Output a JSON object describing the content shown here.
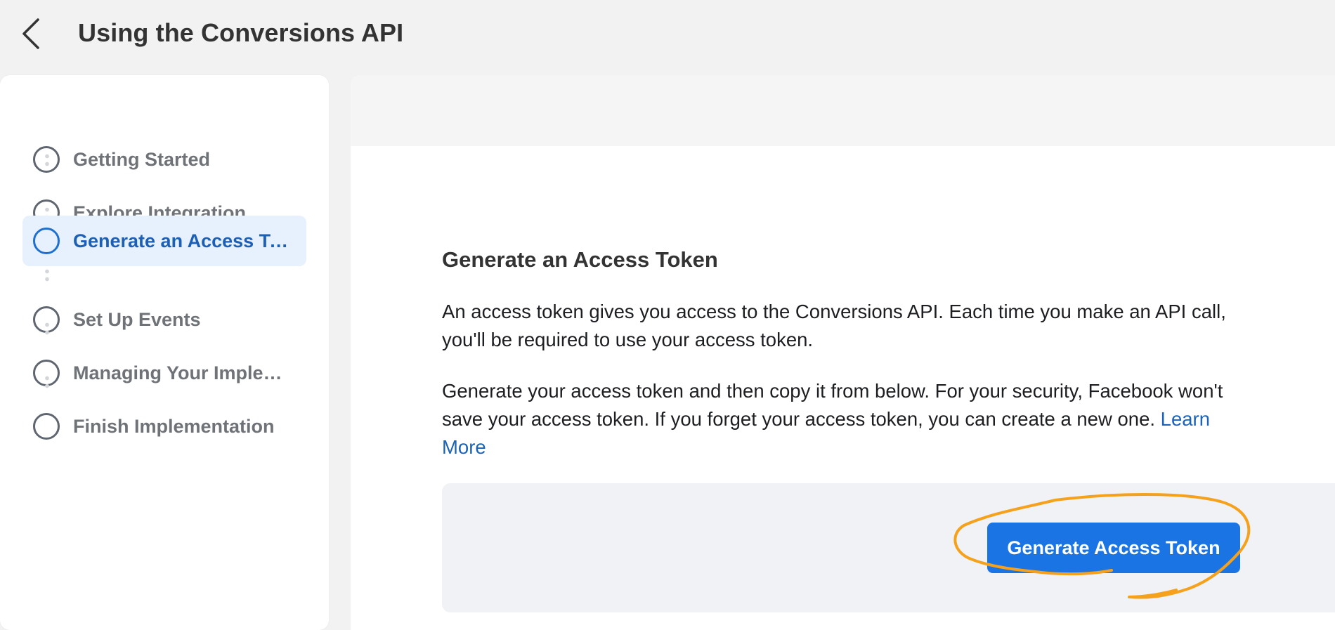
{
  "header": {
    "title": "Using the Conversions API",
    "back_icon": "chevron-left-icon"
  },
  "sidebar": {
    "steps": [
      {
        "label": "Getting Started",
        "active": false
      },
      {
        "label": "Explore Integration",
        "active": false
      },
      {
        "label": "Generate an Access To…",
        "active": true
      },
      {
        "label": "Set Up Events",
        "active": false
      },
      {
        "label": "Managing Your Implem…",
        "active": false
      },
      {
        "label": "Finish Implementation",
        "active": false
      }
    ]
  },
  "main": {
    "section_title": "Generate an Access Token",
    "paragraph1": "An access token gives you access to the Conversions API. Each time you make an API call, you'll be required to use your access token.",
    "paragraph2": "Generate your access token and then copy it from below. For your security, Facebook won't save your access token. If you forget your access token, you can create a new one.",
    "learn_more_link": "Learn More",
    "generate_button": "Generate Access Token"
  },
  "colors": {
    "accent": "#1b74e4",
    "active_step_bg": "#e7f1fd",
    "active_step_text": "#1c5fb6",
    "annotation": "#f5a11c"
  }
}
